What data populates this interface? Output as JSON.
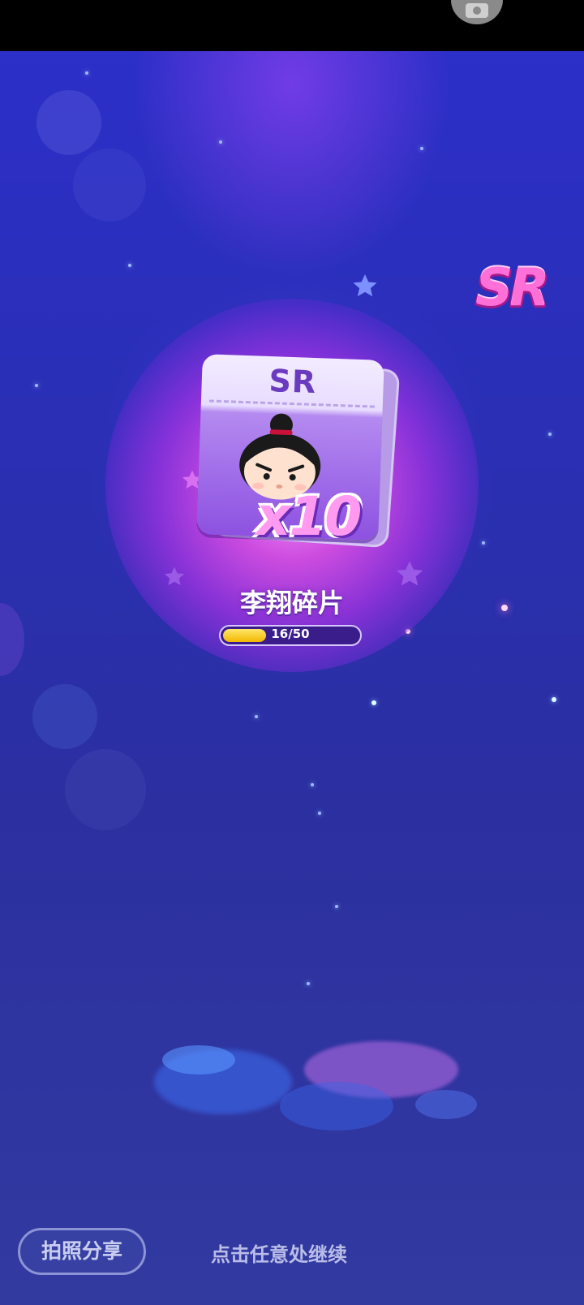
{
  "rarity_badge": "SR",
  "card": {
    "rarity_label": "SR",
    "count_label": "x10"
  },
  "item": {
    "name": "李翔碎片"
  },
  "progress": {
    "label": "16/50",
    "current": 16,
    "total": 50,
    "fraction": 0.32,
    "fill_color": "#f5c400"
  },
  "buttons": {
    "share_label": "拍照分享"
  },
  "hint": {
    "continue_label": "点击任意处继续"
  },
  "icons": {
    "camera": "camera-icon",
    "sparkle": "star-icon"
  },
  "colors": {
    "background": "#2a2fb5",
    "glow": "#e050e8",
    "card": "#9e6ae8",
    "badge": "#ff6fd8"
  }
}
